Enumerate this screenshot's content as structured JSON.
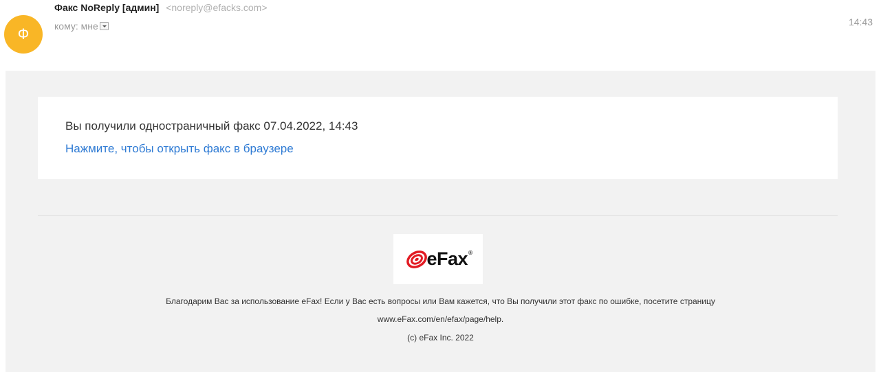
{
  "email": {
    "avatar_letter": "Ф",
    "avatar_color": "#f9b626",
    "sender_name": "Факс NoReply [админ]",
    "sender_email": "<noreply@efacks.com>",
    "recipient": "кому: мне",
    "time": "14:43"
  },
  "message": {
    "text": "Вы получили одностраничный факс 07.04.2022, 14:43",
    "link": "Нажмите, чтобы открыть факс в браузере",
    "link_color": "#2f7bd4"
  },
  "logo": {
    "text": "eFax",
    "registered": "®",
    "swirl_color": "#e21b23"
  },
  "footer": {
    "line1": "Благодарим Вас за использование eFax! Если у Вас есть вопросы или Вам кажется, что Вы получили этот факс по ошибке, посетите страницу",
    "line2": "www.eFax.com/en/efax/page/help.",
    "line3": "(c) eFax Inc. 2022"
  }
}
